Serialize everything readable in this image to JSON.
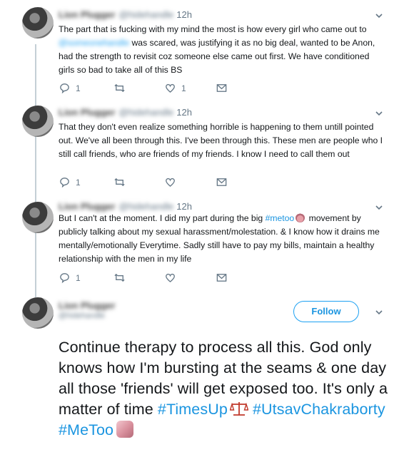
{
  "tweets": [
    {
      "name": "Lion Plugger",
      "handle": "@hidehandle",
      "time": "12h",
      "text_before_mention": "The part that is fucking with my mind the most is how every girl who came out to",
      "mention": "@someonehandle",
      "text_after_mention": " was scared, was justifying it as no big deal, wanted to be Anon, had the strength to revisit coz someone else came out first. We have conditioned girls so bad to take all of this BS",
      "replies": "1",
      "retweets": "",
      "likes": "1"
    },
    {
      "name": "Lion Plugger",
      "handle": "@hidehandle",
      "time": "12h",
      "text": "That they don't even realize something horrible is happening to them untill pointed out. We've all been through this. I've been through this. These men are people who I still call friends, who are friends of my friends. I know I need to call them out",
      "replies": "1",
      "retweets": "",
      "likes": ""
    },
    {
      "name": "Lion Plugger",
      "handle": "@hidehandle",
      "time": "12h",
      "text_before_tag": "But I can't at the moment. I did my part during the big ",
      "hashtag": "#metoo",
      "text_after_tag": " movement by publicly talking about my sexual harassment/molestation. & I know how it drains me mentally/emotionally Everytime. Sadly still have to pay my bills, maintain a healthy relationship with the men in my life",
      "replies": "1",
      "retweets": "",
      "likes": ""
    }
  ],
  "main_tweet": {
    "name": "Lion Plugger",
    "handle": "@hidehandle",
    "follow_label": "Follow",
    "text": "Continue therapy to process all this. God only knows how I'm bursting at the seams & one day all those 'friends' will get exposed too. It's only a matter of time ",
    "hashtag_1": "#TimesUp",
    "hashtag_2": "#UtsavChakraborty",
    "hashtag_3": "#MeToo"
  },
  "icons": {
    "reply": "reply-icon",
    "retweet": "retweet-icon",
    "like": "heart-icon",
    "dm": "envelope-icon",
    "more": "chevron-down-icon"
  },
  "colors": {
    "link": "#1b95e0",
    "follow_border": "#1da1f2",
    "muted": "#657786"
  }
}
